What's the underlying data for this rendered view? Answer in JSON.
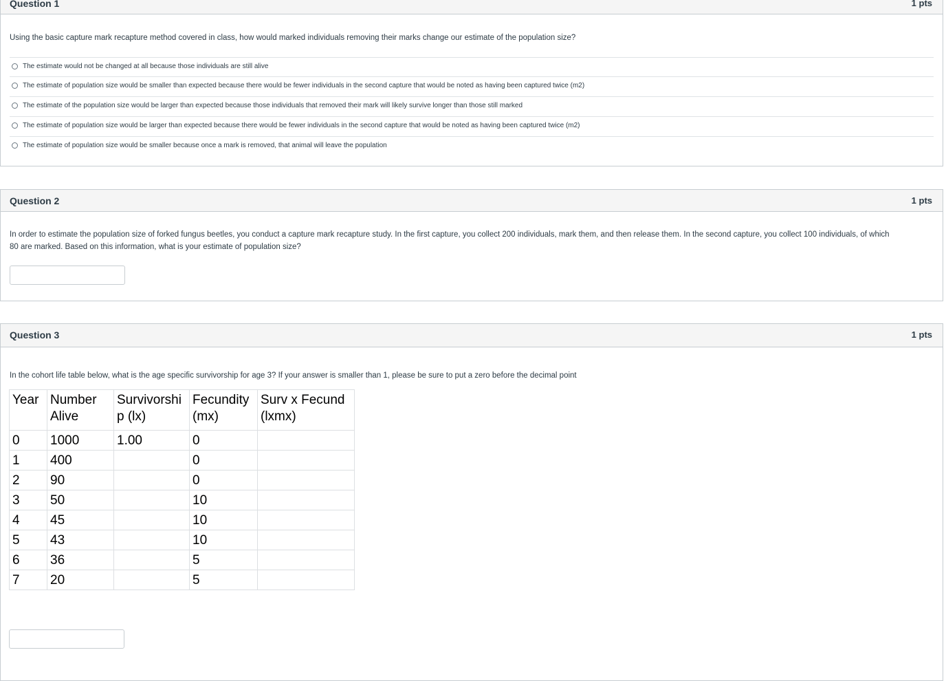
{
  "questions": [
    {
      "title": "Question 1",
      "points": "1 pts",
      "text": "Using the basic capture mark recapture method covered in class, how would marked individuals removing their marks change our estimate of the population size?",
      "answers": [
        "The estimate would not be changed at all because those individuals are still alive",
        "The estimate of population size would be smaller than expected because there would be fewer individuals in the second capture that would be noted as having been captured twice (m2)",
        "The estimate of the population size would be larger than expected because those individuals that removed their mark will likely survive longer than those still marked",
        "The estimate of population size would be larger than expected because there would be fewer individuals in the second capture that would be noted as having been captured twice (m2)",
        "The estimate of population size would be smaller because once a mark is removed, that animal will leave the population"
      ]
    },
    {
      "title": "Question 2",
      "points": "1 pts",
      "text_line1": "In order to estimate the population size of forked fungus beetles, you conduct a capture mark recapture study.  In the first capture, you collect 200 individuals, mark them, and then release them.  In the second capture, you collect 100 individuals, of which",
      "text_line2": "80 are marked.  Based on this information, what is your estimate of population size?",
      "answer_value": ""
    },
    {
      "title": "Question 3",
      "points": "1 pts",
      "text": "In the cohort life table below, what is the age specific survivorship for age 3? If your answer is smaller than 1, please be sure to put a zero before the decimal point",
      "table": {
        "headers": [
          [
            "Year",
            ""
          ],
          [
            "Number",
            "Alive"
          ],
          [
            "Survivorshi",
            "p (lx)"
          ],
          [
            "Fecundity",
            "(mx)"
          ],
          [
            "Surv x Fecund",
            "(lxmx)"
          ]
        ],
        "rows": [
          [
            "0",
            "1000",
            "1.00",
            "0",
            ""
          ],
          [
            "1",
            "400",
            "",
            "0",
            ""
          ],
          [
            "2",
            "90",
            "",
            "0",
            ""
          ],
          [
            "3",
            "50",
            "",
            "10",
            ""
          ],
          [
            "4",
            "45",
            "",
            "10",
            ""
          ],
          [
            "5",
            "43",
            "",
            "10",
            ""
          ],
          [
            "6",
            "36",
            "",
            "5",
            ""
          ],
          [
            "7",
            "20",
            "",
            "5",
            ""
          ]
        ]
      },
      "answer_value": ""
    }
  ]
}
